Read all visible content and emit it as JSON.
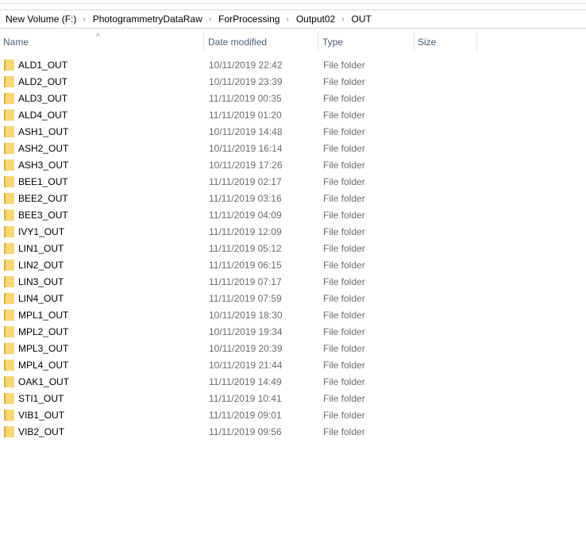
{
  "breadcrumb": [
    "New Volume (F:)",
    "PhotogrammetryDataRaw",
    "ForProcessing",
    "Output02",
    "OUT"
  ],
  "columns": {
    "name": "Name",
    "date": "Date modified",
    "type": "Type",
    "size": "Size"
  },
  "rows": [
    {
      "name": "ALD1_OUT",
      "date": "10/11/2019 22:42",
      "type": "File folder"
    },
    {
      "name": "ALD2_OUT",
      "date": "10/11/2019 23:39",
      "type": "File folder"
    },
    {
      "name": "ALD3_OUT",
      "date": "11/11/2019 00:35",
      "type": "File folder"
    },
    {
      "name": "ALD4_OUT",
      "date": "11/11/2019 01:20",
      "type": "File folder"
    },
    {
      "name": "ASH1_OUT",
      "date": "10/11/2019 14:48",
      "type": "File folder"
    },
    {
      "name": "ASH2_OUT",
      "date": "10/11/2019 16:14",
      "type": "File folder"
    },
    {
      "name": "ASH3_OUT",
      "date": "10/11/2019 17:26",
      "type": "File folder"
    },
    {
      "name": "BEE1_OUT",
      "date": "11/11/2019 02:17",
      "type": "File folder"
    },
    {
      "name": "BEE2_OUT",
      "date": "11/11/2019 03:16",
      "type": "File folder"
    },
    {
      "name": "BEE3_OUT",
      "date": "11/11/2019 04:09",
      "type": "File folder"
    },
    {
      "name": "IVY1_OUT",
      "date": "11/11/2019 12:09",
      "type": "File folder"
    },
    {
      "name": "LIN1_OUT",
      "date": "11/11/2019 05:12",
      "type": "File folder"
    },
    {
      "name": "LIN2_OUT",
      "date": "11/11/2019 06:15",
      "type": "File folder"
    },
    {
      "name": "LIN3_OUT",
      "date": "11/11/2019 07:17",
      "type": "File folder"
    },
    {
      "name": "LIN4_OUT",
      "date": "11/11/2019 07:59",
      "type": "File folder"
    },
    {
      "name": "MPL1_OUT",
      "date": "10/11/2019 18:30",
      "type": "File folder"
    },
    {
      "name": "MPL2_OUT",
      "date": "10/11/2019 19:34",
      "type": "File folder"
    },
    {
      "name": "MPL3_OUT",
      "date": "10/11/2019 20:39",
      "type": "File folder"
    },
    {
      "name": "MPL4_OUT",
      "date": "10/11/2019 21:44",
      "type": "File folder"
    },
    {
      "name": "OAK1_OUT",
      "date": "11/11/2019 14:49",
      "type": "File folder"
    },
    {
      "name": "STI1_OUT",
      "date": "11/11/2019 10:41",
      "type": "File folder"
    },
    {
      "name": "VIB1_OUT",
      "date": "11/11/2019 09:01",
      "type": "File folder"
    },
    {
      "name": "VIB2_OUT",
      "date": "11/11/2019 09:56",
      "type": "File folder"
    }
  ]
}
